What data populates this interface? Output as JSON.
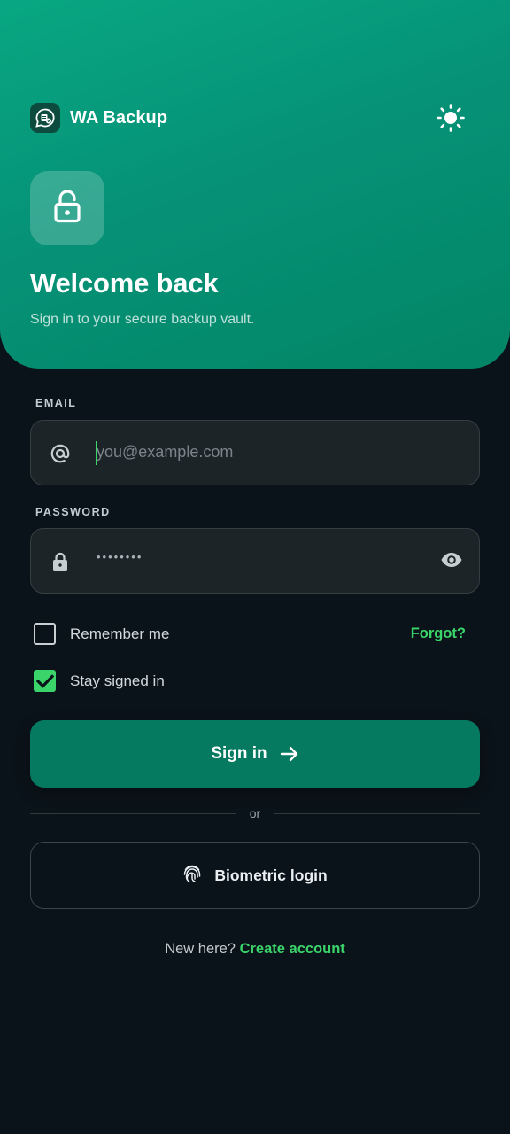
{
  "app": {
    "name": "WA Backup"
  },
  "hero": {
    "title": "Welcome back",
    "subtitle": "Sign in to your secure backup vault."
  },
  "form": {
    "email": {
      "label": "EMAIL",
      "placeholder": "you@example.com",
      "value": ""
    },
    "password": {
      "label": "PASSWORD",
      "masked_value": "••••••••"
    },
    "remember_me": {
      "label": "Remember me",
      "checked": false
    },
    "stay_signed_in": {
      "label": "Stay signed in",
      "checked": true
    },
    "forgot_label": "Forgot?",
    "submit_label": "Sign in"
  },
  "divider_text": "or",
  "biometric_label": "Biometric login",
  "footer": {
    "prompt": "New here?",
    "link": "Create account"
  },
  "icons": {
    "brand": "whatsapp-backup-icon",
    "theme": "sun-icon",
    "hero": "unlocked-padlock-icon",
    "email_field": "at-sign-icon",
    "password_field": "lock-icon",
    "password_toggle": "eye-icon",
    "submit": "arrow-right-icon",
    "biometric": "fingerprint-icon"
  },
  "colors": {
    "primary": "#069277",
    "accent": "#3ad46a",
    "background": "#0b131a",
    "field_background": "#1c2428"
  }
}
